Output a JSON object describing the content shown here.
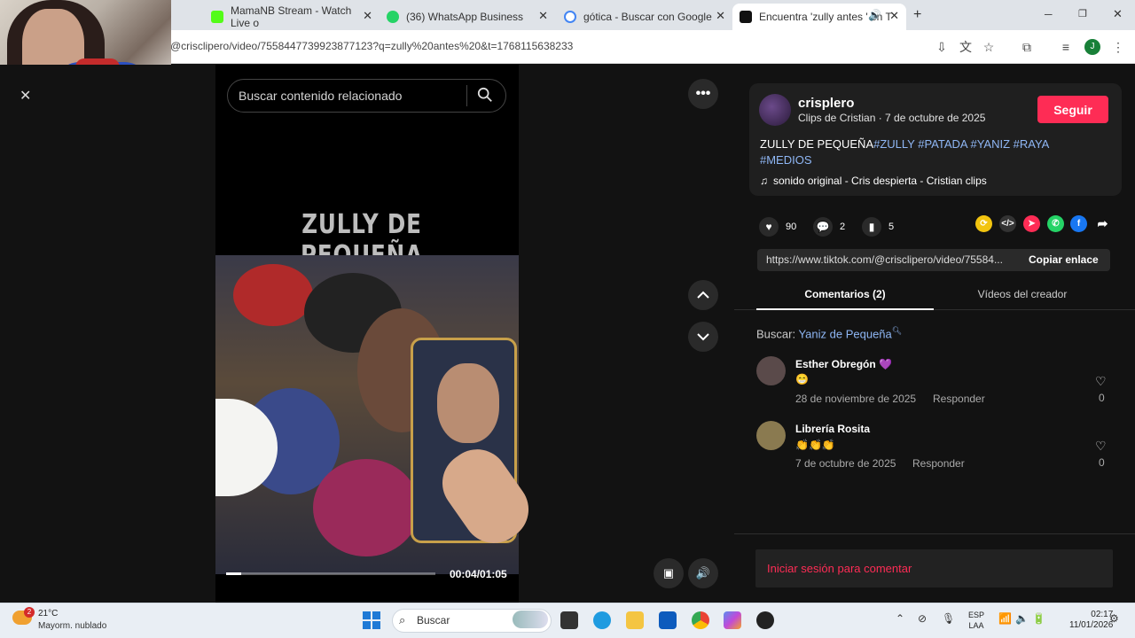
{
  "browser": {
    "tabs": [
      {
        "title": "MamaNB Stream - Watch Live o",
        "fav_color": "#53fc18",
        "active": false
      },
      {
        "title": "(36) WhatsApp Business",
        "fav_color": "#25d366",
        "active": false
      },
      {
        "title": "gótica - Buscar con Google",
        "fav_color": "#4285f4",
        "active": false
      },
      {
        "title": "Encuentra 'zully antes ' en T",
        "fav_color": "#111111",
        "active": true
      }
    ],
    "new_tab_label": "+",
    "url": "@crisclipero/video/7558447739923877123?q=zully%20antes%20&t=1768115638233",
    "profile_initial": "J"
  },
  "search": {
    "placeholder": "Buscar contenido relacionado"
  },
  "video": {
    "overlay_title": "ZULLY DE PEQUEÑA",
    "timecode": "00:04/01:05",
    "progress_fraction": 0.07
  },
  "post": {
    "username": "crisplero",
    "subline": "Clips de Cristian · 7 de octubre de 2025",
    "follow_label": "Seguir",
    "desc_text": "ZULLY DE PEQUEÑA",
    "tags_line1": "#ZULLY #PATADA #YANIZ #RAYA",
    "tags_line2": "#MEDIOS",
    "music": "sonido original - Cris despierta - Cristian clips",
    "likes": "90",
    "comments": "2",
    "saves": "5",
    "link": "https://www.tiktok.com/@crisclipero/video/75584...",
    "copy_label": "Copiar enlace"
  },
  "tabs": {
    "comments_label": "Comentarios (2)",
    "videos_label": "Vídeos del creador"
  },
  "search_suggest": {
    "prefix": "Buscar:",
    "term": "Yaniz de Pequeña"
  },
  "comments": [
    {
      "name": "Esther Obregón 💜",
      "text": "😁",
      "date": "28 de noviembre de 2025",
      "reply": "Responder",
      "likes": "0",
      "avatar_color": "#5a4a4a"
    },
    {
      "name": "Librería Rosita",
      "text": "👏👏👏",
      "date": "7 de octubre de 2025",
      "reply": "Responder",
      "likes": "0",
      "avatar_color": "#8a7a50"
    }
  ],
  "login_prompt": "Iniciar sesión para comentar",
  "taskbar": {
    "temp": "21°C",
    "weather": "Mayorm. nublado",
    "weather_badge": "2",
    "search_label": "Buscar",
    "lang_line1": "ESP",
    "lang_line2": "LAA",
    "time": "02:17",
    "date": "11/01/2026"
  },
  "colors": {
    "accent": "#fe2c55",
    "tag": "#8fb7f5"
  }
}
